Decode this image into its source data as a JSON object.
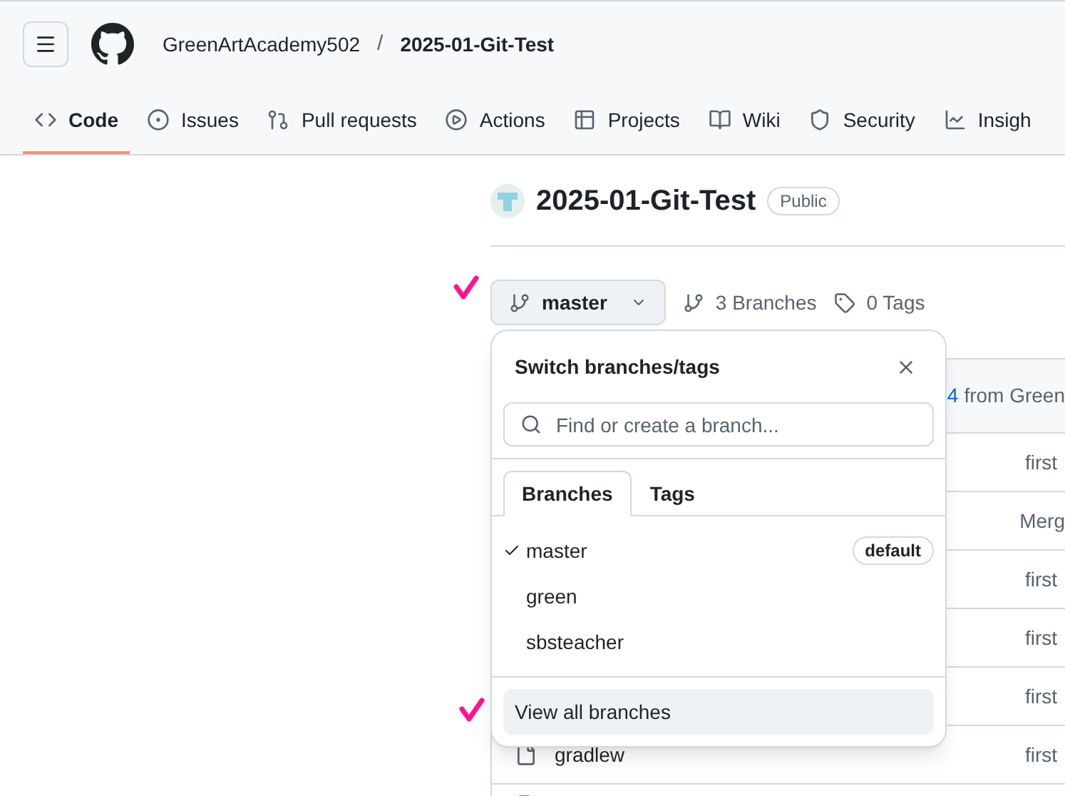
{
  "header": {
    "owner": "GreenArtAcademy502",
    "separator": "/",
    "repo": "2025-01-Git-Test"
  },
  "nav_tabs": [
    {
      "label": "Code",
      "selected": true
    },
    {
      "label": "Issues",
      "selected": false
    },
    {
      "label": "Pull requests",
      "selected": false
    },
    {
      "label": "Actions",
      "selected": false
    },
    {
      "label": "Projects",
      "selected": false
    },
    {
      "label": "Wiki",
      "selected": false
    },
    {
      "label": "Security",
      "selected": false
    },
    {
      "label": "Insigh",
      "selected": false
    }
  ],
  "repo": {
    "title": "2025-01-Git-Test",
    "visibility": "Public"
  },
  "branch_bar": {
    "current_branch": "master",
    "branches_count": "3 Branches",
    "tags_count": "0 Tags"
  },
  "commit_bar": {
    "pr_number": "4",
    "text": "from Green"
  },
  "file_rows": [
    {
      "name": "",
      "message": "first"
    },
    {
      "name": "",
      "message": "Merg"
    },
    {
      "name": "",
      "message": "first"
    },
    {
      "name": "",
      "message": "first"
    },
    {
      "name": "",
      "message": "first"
    },
    {
      "name": "gradlew",
      "message": "first"
    }
  ],
  "branch_menu": {
    "title": "Switch branches/tags",
    "search_placeholder": "Find or create a branch...",
    "tabs": [
      {
        "label": "Branches",
        "selected": true
      },
      {
        "label": "Tags",
        "selected": false
      }
    ],
    "branches": [
      {
        "name": "master",
        "selected": true,
        "badge": "default"
      },
      {
        "name": "green",
        "selected": false
      },
      {
        "name": "sbsteacher",
        "selected": false
      }
    ],
    "footer_link": "View all branches"
  }
}
